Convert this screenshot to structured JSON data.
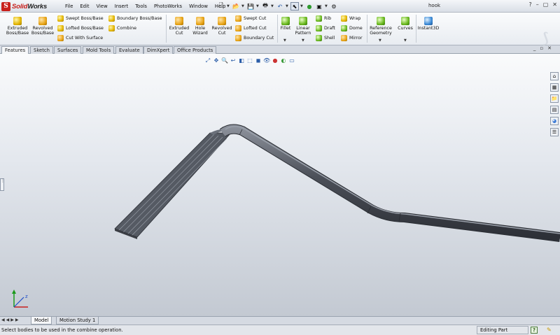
{
  "app": {
    "logo_mark": "S",
    "logo_text_1": "Solid",
    "logo_text_2": "Works",
    "document_title": "hook"
  },
  "menu": [
    "File",
    "Edit",
    "View",
    "Insert",
    "Tools",
    "PhotoWorks",
    "Window",
    "Help"
  ],
  "quick_access": [
    "new-icon",
    "open-icon",
    "save-icon",
    "print-icon",
    "undo-icon",
    "select-icon",
    "rebuild-icon",
    "options-icon"
  ],
  "window_controls": [
    "?",
    "–",
    "▢",
    "✕"
  ],
  "ribbon": {
    "extruded_boss": "Extruded Boss/Base",
    "revolved_boss": "Revolved Boss/Base",
    "swept_boss": "Swept Boss/Base",
    "lofted_boss": "Lofted Boss/Base",
    "cut_with_surface": "Cut With Surface",
    "boundary_boss": "Boundary Boss/Base",
    "combine": "Combine",
    "extruded_cut": "Extruded Cut",
    "hole_wizard": "Hole Wizard",
    "revolved_cut": "Revolved Cut",
    "swept_cut": "Swept Cut",
    "lofted_cut": "Lofted Cut",
    "boundary_cut": "Boundary Cut",
    "fillet": "Fillet",
    "linear_pattern": "Linear Pattern",
    "rib": "Rib",
    "draft": "Draft",
    "shell": "Shell",
    "wrap": "Wrap",
    "dome": "Dome",
    "mirror": "Mirror",
    "reference_geometry": "Reference Geometry",
    "curves": "Curves",
    "instant3d": "Instant3D"
  },
  "tabs": [
    "Features",
    "Sketch",
    "Surfaces",
    "Mold Tools",
    "Evaluate",
    "DimXpert",
    "Office Products"
  ],
  "active_tab": "Features",
  "bottom_tabs": [
    "Model",
    "Motion Study 1"
  ],
  "active_bottom_tab": "Model",
  "status": {
    "message": "Select bodies to be used in the combine operation.",
    "mode": "Editing Part",
    "help": "?"
  },
  "colors": {
    "accent": "#c8201c",
    "model": "#4a4e57",
    "viewport_top": "#fafbfc",
    "viewport_bottom": "#c3c9d2"
  }
}
